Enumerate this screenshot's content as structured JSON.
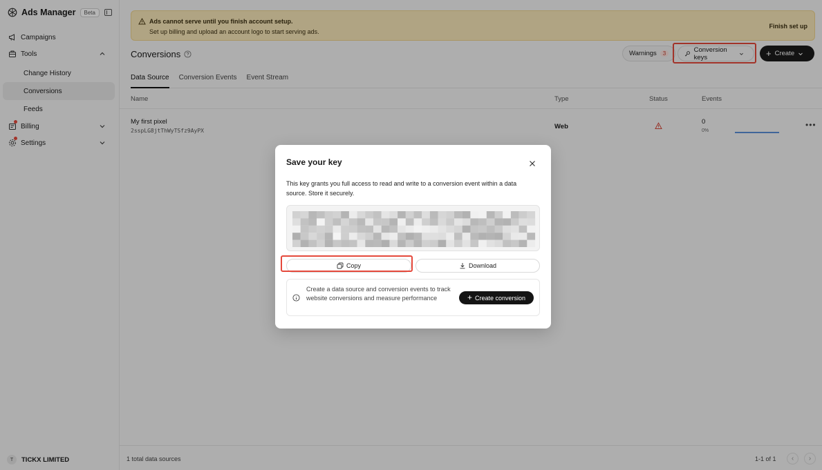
{
  "app": {
    "name": "Ads Manager",
    "badge": "Beta"
  },
  "sidebar": {
    "items": [
      {
        "label": "Campaigns"
      },
      {
        "label": "Tools"
      },
      {
        "label": "Change History"
      },
      {
        "label": "Conversions"
      },
      {
        "label": "Feeds"
      },
      {
        "label": "Billing"
      },
      {
        "label": "Settings"
      }
    ],
    "org": {
      "initial": "T",
      "name": "TICKX LIMITED"
    }
  },
  "banner": {
    "title": "Ads cannot serve until you finish account setup.",
    "message": "Set up billing and upload an account logo to start serving ads.",
    "action": "Finish set up"
  },
  "header": {
    "title": "Conversions",
    "warnings_label": "Warnings",
    "warnings_count": "3",
    "conversion_keys_label": "Conversion keys",
    "create_label": "Create"
  },
  "tabs": [
    {
      "label": "Data Source"
    },
    {
      "label": "Conversion Events"
    },
    {
      "label": "Event Stream"
    }
  ],
  "table": {
    "columns": [
      "Name",
      "Type",
      "Status",
      "Events"
    ],
    "rows": [
      {
        "name": "My first pixel",
        "id": "2sspLG8jtThWyTSfz9AyPX",
        "type": "Web",
        "events": "0",
        "percent": "0%",
        "progress": 0.45
      }
    ],
    "footer_total": "1 total data sources",
    "pagination": "1-1 of 1"
  },
  "modal": {
    "title": "Save your key",
    "description": "This key grants you full access to read and write to a conversion event within a data source. Store it securely.",
    "copy_label": "Copy",
    "download_label": "Download",
    "info_text": "Create a data source and conversion events to track website conversions and measure performance",
    "create_conversion_label": "Create conversion"
  },
  "colors": {
    "accent": "#1b1b1b",
    "highlight": "#e5483b",
    "banner": "#f8e7b9",
    "progress": "#5b8fd8"
  }
}
